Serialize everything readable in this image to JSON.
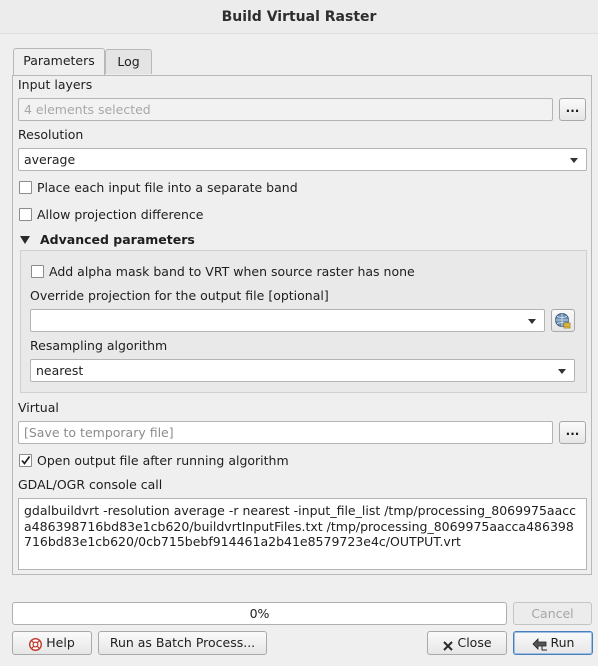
{
  "window": {
    "title": "Build Virtual Raster"
  },
  "tabs": [
    {
      "label": "Parameters",
      "active": true
    },
    {
      "label": "Log",
      "active": false
    }
  ],
  "params": {
    "input_layers": {
      "label": "Input layers",
      "value": "4 elements selected",
      "browse_label": "..."
    },
    "resolution": {
      "label": "Resolution",
      "value": "average"
    },
    "separate_band": {
      "label": "Place each input file into a separate band",
      "checked": false
    },
    "proj_difference": {
      "label": "Allow projection difference",
      "checked": false
    },
    "advanced": {
      "header": "Advanced parameters",
      "expanded": true,
      "alpha_mask": {
        "label": "Add alpha mask band to VRT when source raster has none",
        "checked": false
      },
      "override_projection": {
        "label": "Override projection for the output file [optional]",
        "value": ""
      },
      "resampling": {
        "label": "Resampling algorithm",
        "value": "nearest"
      }
    },
    "virtual": {
      "label": "Virtual",
      "placeholder": "[Save to temporary file]",
      "browse_label": "..."
    },
    "open_output": {
      "label": "Open output file after running algorithm",
      "checked": true
    },
    "console": {
      "label": "GDAL/OGR console call",
      "text": "gdalbuildvrt -resolution average -r nearest -input_file_list /tmp/processing_8069975aacca486398716bd83e1cb620/buildvrtInputFiles.txt /tmp/processing_8069975aacca486398716bd83e1cb620/0cb715bebf914461a2b41e8579723e4c/OUTPUT.vrt"
    }
  },
  "progress": {
    "value": 0,
    "text": "0%"
  },
  "buttons": {
    "cancel": "Cancel",
    "help": "Help",
    "batch": "Run as Batch Process...",
    "close": "Close",
    "run": "Run"
  },
  "colors": {
    "accent": "#4a7ebb",
    "background": "#efefef",
    "disabled_text": "#a8a8a8"
  }
}
